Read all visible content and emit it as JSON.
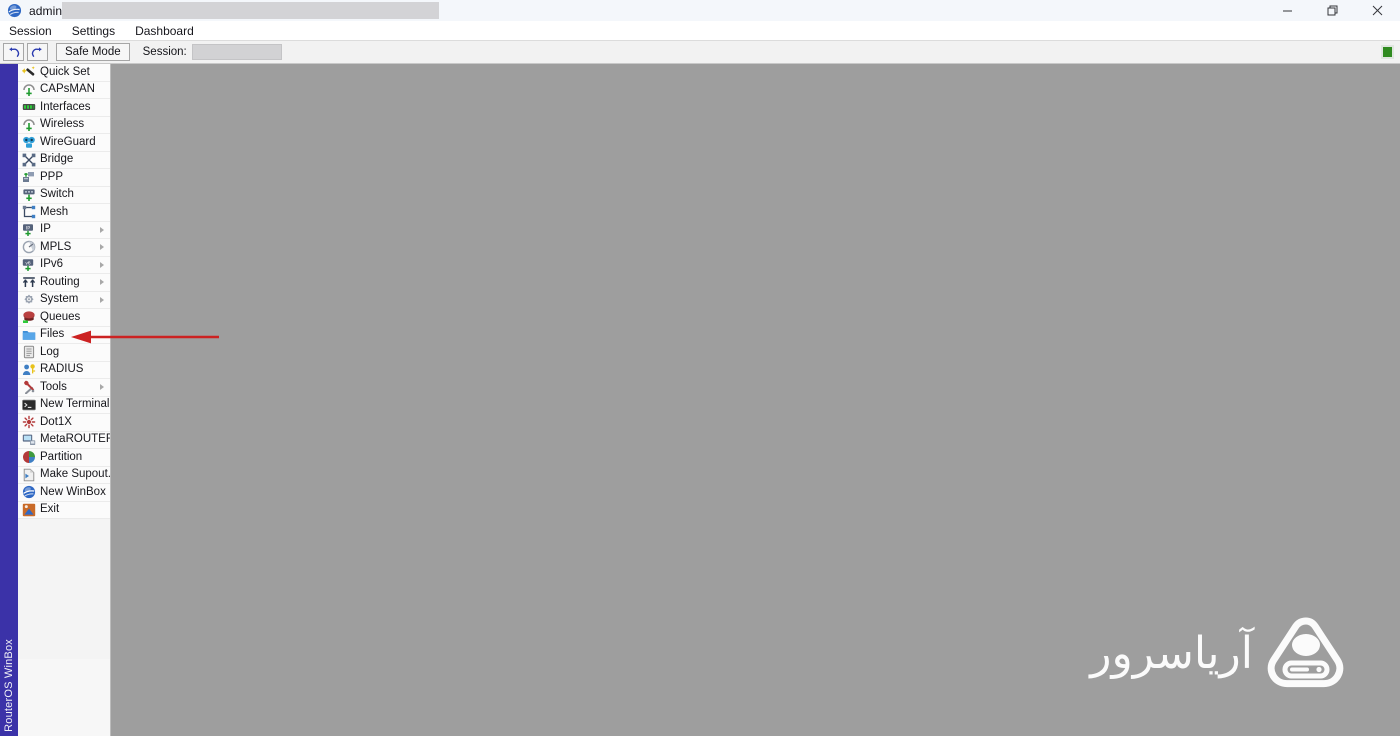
{
  "window": {
    "title": "admin@",
    "app_icon": "winbox-globe-icon",
    "host_redacted": true,
    "controls": [
      {
        "name": "minimize",
        "glyph": "minimize-icon"
      },
      {
        "name": "restore",
        "glyph": "restore-icon"
      },
      {
        "name": "close",
        "glyph": "close-icon"
      }
    ]
  },
  "menubar": {
    "items": [
      {
        "label": "Session"
      },
      {
        "label": "Settings"
      },
      {
        "label": "Dashboard"
      }
    ]
  },
  "toolbar": {
    "undo_icon": "undo-icon",
    "redo_icon": "redo-icon",
    "safe_mode_label": "Safe Mode",
    "session_label": "Session:",
    "session_value": "",
    "status_indicator_color": "#2f8a1f"
  },
  "rail": {
    "label": "RouterOS WinBox",
    "color": "#3b32a8"
  },
  "sidebar": {
    "items": [
      {
        "label": "Quick Set",
        "icon": "magic-wand-icon",
        "submenu": false
      },
      {
        "label": "CAPsMAN",
        "icon": "antenna-icon",
        "submenu": false
      },
      {
        "label": "Interfaces",
        "icon": "interfaces-icon",
        "submenu": false
      },
      {
        "label": "Wireless",
        "icon": "antenna-icon",
        "submenu": false
      },
      {
        "label": "WireGuard",
        "icon": "wireguard-icon",
        "submenu": false
      },
      {
        "label": "Bridge",
        "icon": "bridge-icon",
        "submenu": false
      },
      {
        "label": "PPP",
        "icon": "ppp-icon",
        "submenu": false
      },
      {
        "label": "Switch",
        "icon": "switch-icon",
        "submenu": false
      },
      {
        "label": "Mesh",
        "icon": "mesh-icon",
        "submenu": false
      },
      {
        "label": "IP",
        "icon": "ip-icon",
        "submenu": true
      },
      {
        "label": "MPLS",
        "icon": "mpls-icon",
        "submenu": true
      },
      {
        "label": "IPv6",
        "icon": "ipv6-icon",
        "submenu": true
      },
      {
        "label": "Routing",
        "icon": "routing-icon",
        "submenu": true
      },
      {
        "label": "System",
        "icon": "system-gear-icon",
        "submenu": true
      },
      {
        "label": "Queues",
        "icon": "queues-icon",
        "submenu": false
      },
      {
        "label": "Files",
        "icon": "folder-icon",
        "submenu": false
      },
      {
        "label": "Log",
        "icon": "log-icon",
        "submenu": false
      },
      {
        "label": "RADIUS",
        "icon": "radius-icon",
        "submenu": false
      },
      {
        "label": "Tools",
        "icon": "tools-icon",
        "submenu": true
      },
      {
        "label": "New Terminal",
        "icon": "terminal-icon",
        "submenu": false
      },
      {
        "label": "Dot1X",
        "icon": "dot1x-icon",
        "submenu": false
      },
      {
        "label": "MetaROUTER",
        "icon": "metarouter-icon",
        "submenu": false
      },
      {
        "label": "Partition",
        "icon": "partition-icon",
        "submenu": false
      },
      {
        "label": "Make Supout.rif",
        "icon": "supout-icon",
        "submenu": false
      },
      {
        "label": "New WinBox",
        "icon": "new-winbox-icon",
        "submenu": false
      },
      {
        "label": "Exit",
        "icon": "exit-icon",
        "submenu": false
      }
    ]
  },
  "annotation": {
    "type": "arrow",
    "points_to": "Files",
    "color": "#cc2222"
  },
  "watermark": {
    "text": "آریاسرور",
    "icon": "aria-server-logo",
    "color": "#ffffff"
  },
  "content": {
    "background_color": "#9e9e9e",
    "empty": true
  }
}
